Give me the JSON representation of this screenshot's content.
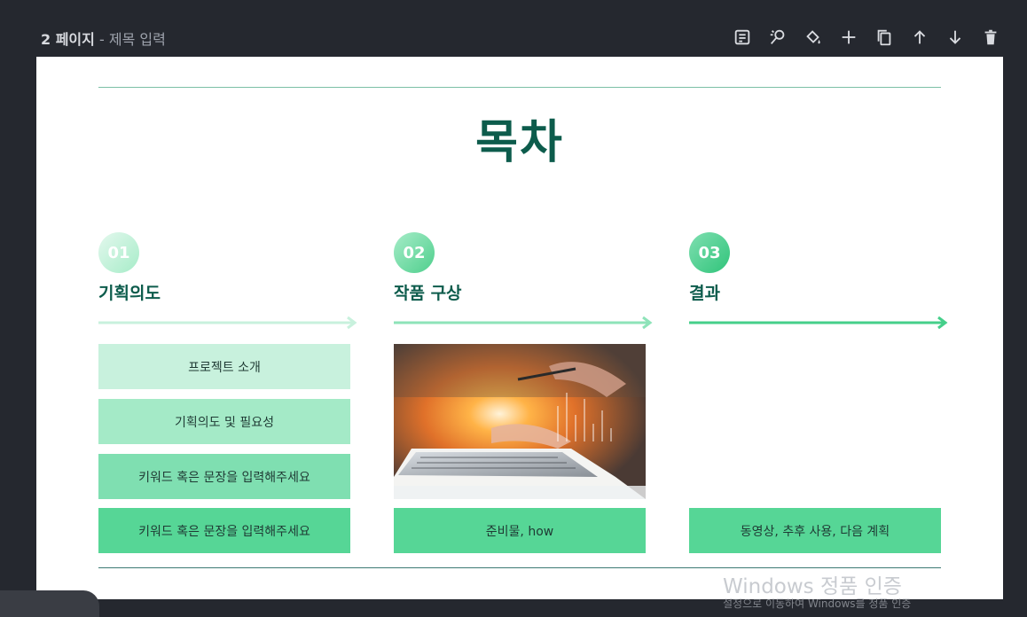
{
  "header": {
    "page_number": "2 페이지",
    "separator": "-",
    "title_placeholder": "제목 입력"
  },
  "toolbar": {
    "buttons": [
      "notes-icon",
      "magic-edit-icon",
      "paint-bucket-icon",
      "add-icon",
      "duplicate-icon",
      "move-up-icon",
      "move-down-icon",
      "delete-icon"
    ]
  },
  "slide": {
    "title": "목차",
    "columns": [
      {
        "number": "01",
        "heading": "기획의도",
        "items": [
          "프로젝트 소개",
          "기획의도 및 필요성",
          "키워드 혹은 문장을 입력해주세요",
          "키워드 혹은 문장을 입력해주세요"
        ]
      },
      {
        "number": "02",
        "heading": "작품 구상",
        "items": [
          "준비물, how"
        ]
      },
      {
        "number": "03",
        "heading": "결과",
        "items": [
          "동영상, 추후 사용, 다음 계획"
        ]
      }
    ]
  },
  "watermark": {
    "line1": "Windows 정품 인증",
    "line2": "설정으로 이동하여 Windows를 정품 인증"
  },
  "colors": {
    "title_green": "#0d5c4c",
    "mint_1": "#c8f1dd",
    "mint_2": "#a4eac7",
    "mint_3": "#7fdfb1",
    "mint_4": "#56d696",
    "background_dark": "#25282f"
  }
}
